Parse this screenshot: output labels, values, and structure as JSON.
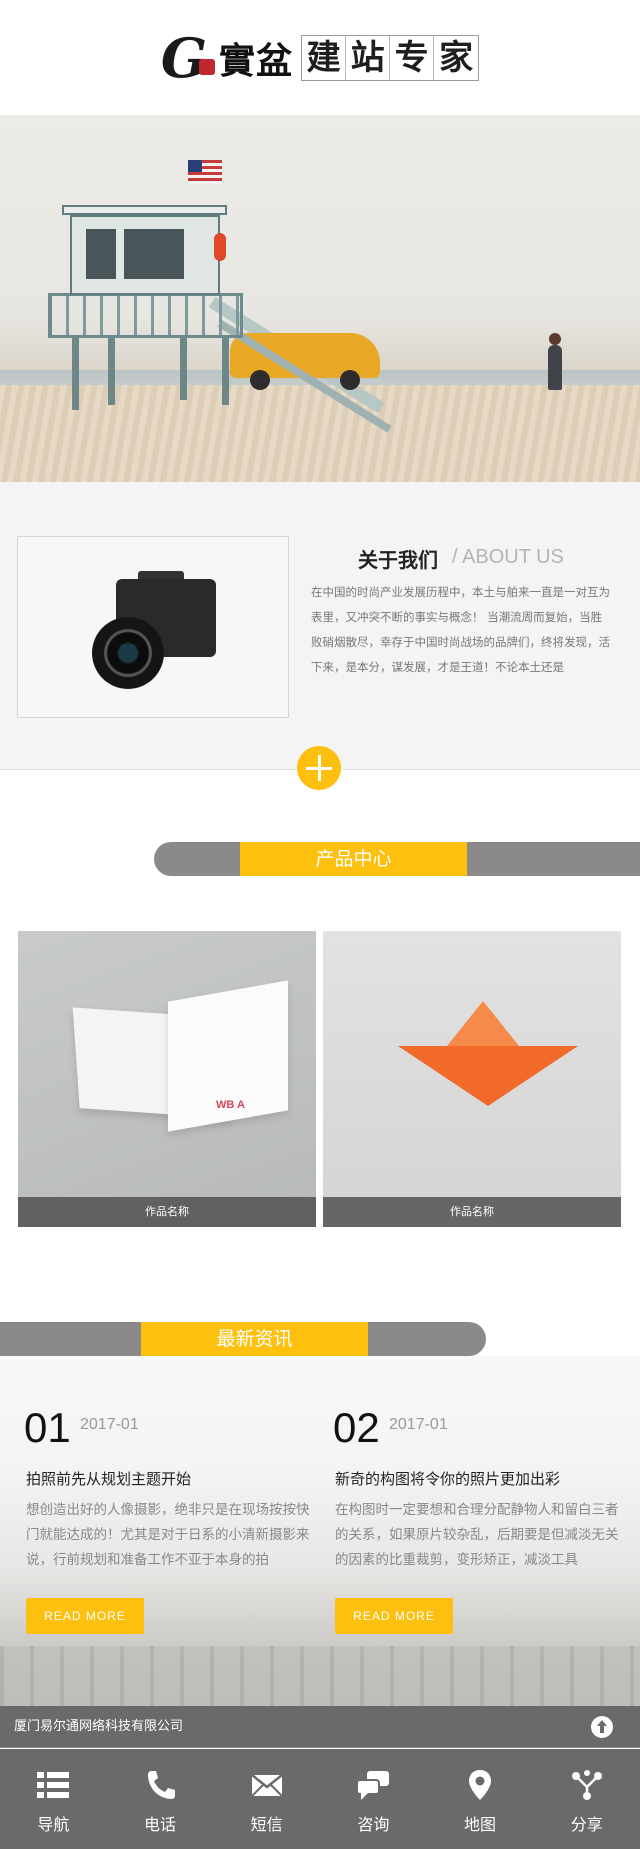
{
  "header": {
    "logo_mark": "G",
    "logo_brand": "實盆",
    "logo_tagline": [
      "建",
      "站",
      "专",
      "家"
    ]
  },
  "about": {
    "title": "关于我们",
    "subtitle": "/ ABOUT US",
    "text": "在中国的时尚产业发展历程中，本土与舶来一直是一对互为表里，又冲突不断的事实与概念！ 当潮流周而复始，当胜败硝烟散尽，幸存于中国时尚战场的品牌们，终将发现，活下来，是本分，谋发展，才是王道！不论本土还是"
  },
  "products": {
    "section_title": "产品中心",
    "items": [
      {
        "caption": "作品名称"
      },
      {
        "caption": "作品名称"
      }
    ],
    "card_mark": "WB A"
  },
  "news": {
    "section_title": "最新资讯",
    "items": [
      {
        "num": "01",
        "date": "2017-01",
        "title": "拍照前先从规划主题开始",
        "text": "想创造出好的人像摄影，绝非只是在现场按按快门就能达成的！尤其是对于日系的小清新摄影来说，行前规划和准备工作不亚于本身的拍",
        "button": "READ MORE"
      },
      {
        "num": "02",
        "date": "2017-01",
        "title": "新奇的构图将令你的照片更加出彩",
        "text": "在构图时一定要想和合理分配静物人和留白三者的关系，如果原片较杂乱，后期要是但减淡无关的因素的比重裁剪，变形矫正，减淡工具",
        "button": "READ MORE"
      }
    ]
  },
  "footer": {
    "company": "厦门易尔通网络科技有限公司",
    "nav": [
      {
        "label": "导航",
        "icon": "list-icon"
      },
      {
        "label": "电话",
        "icon": "phone-icon"
      },
      {
        "label": "短信",
        "icon": "mail-icon"
      },
      {
        "label": "咨询",
        "icon": "chat-icon"
      },
      {
        "label": "地图",
        "icon": "map-pin-icon"
      },
      {
        "label": "分享",
        "icon": "share-icon"
      }
    ]
  },
  "colors": {
    "accent": "#fec00f",
    "bar_gray": "#8a8a88",
    "footer_gray": "#6a6a6a"
  }
}
